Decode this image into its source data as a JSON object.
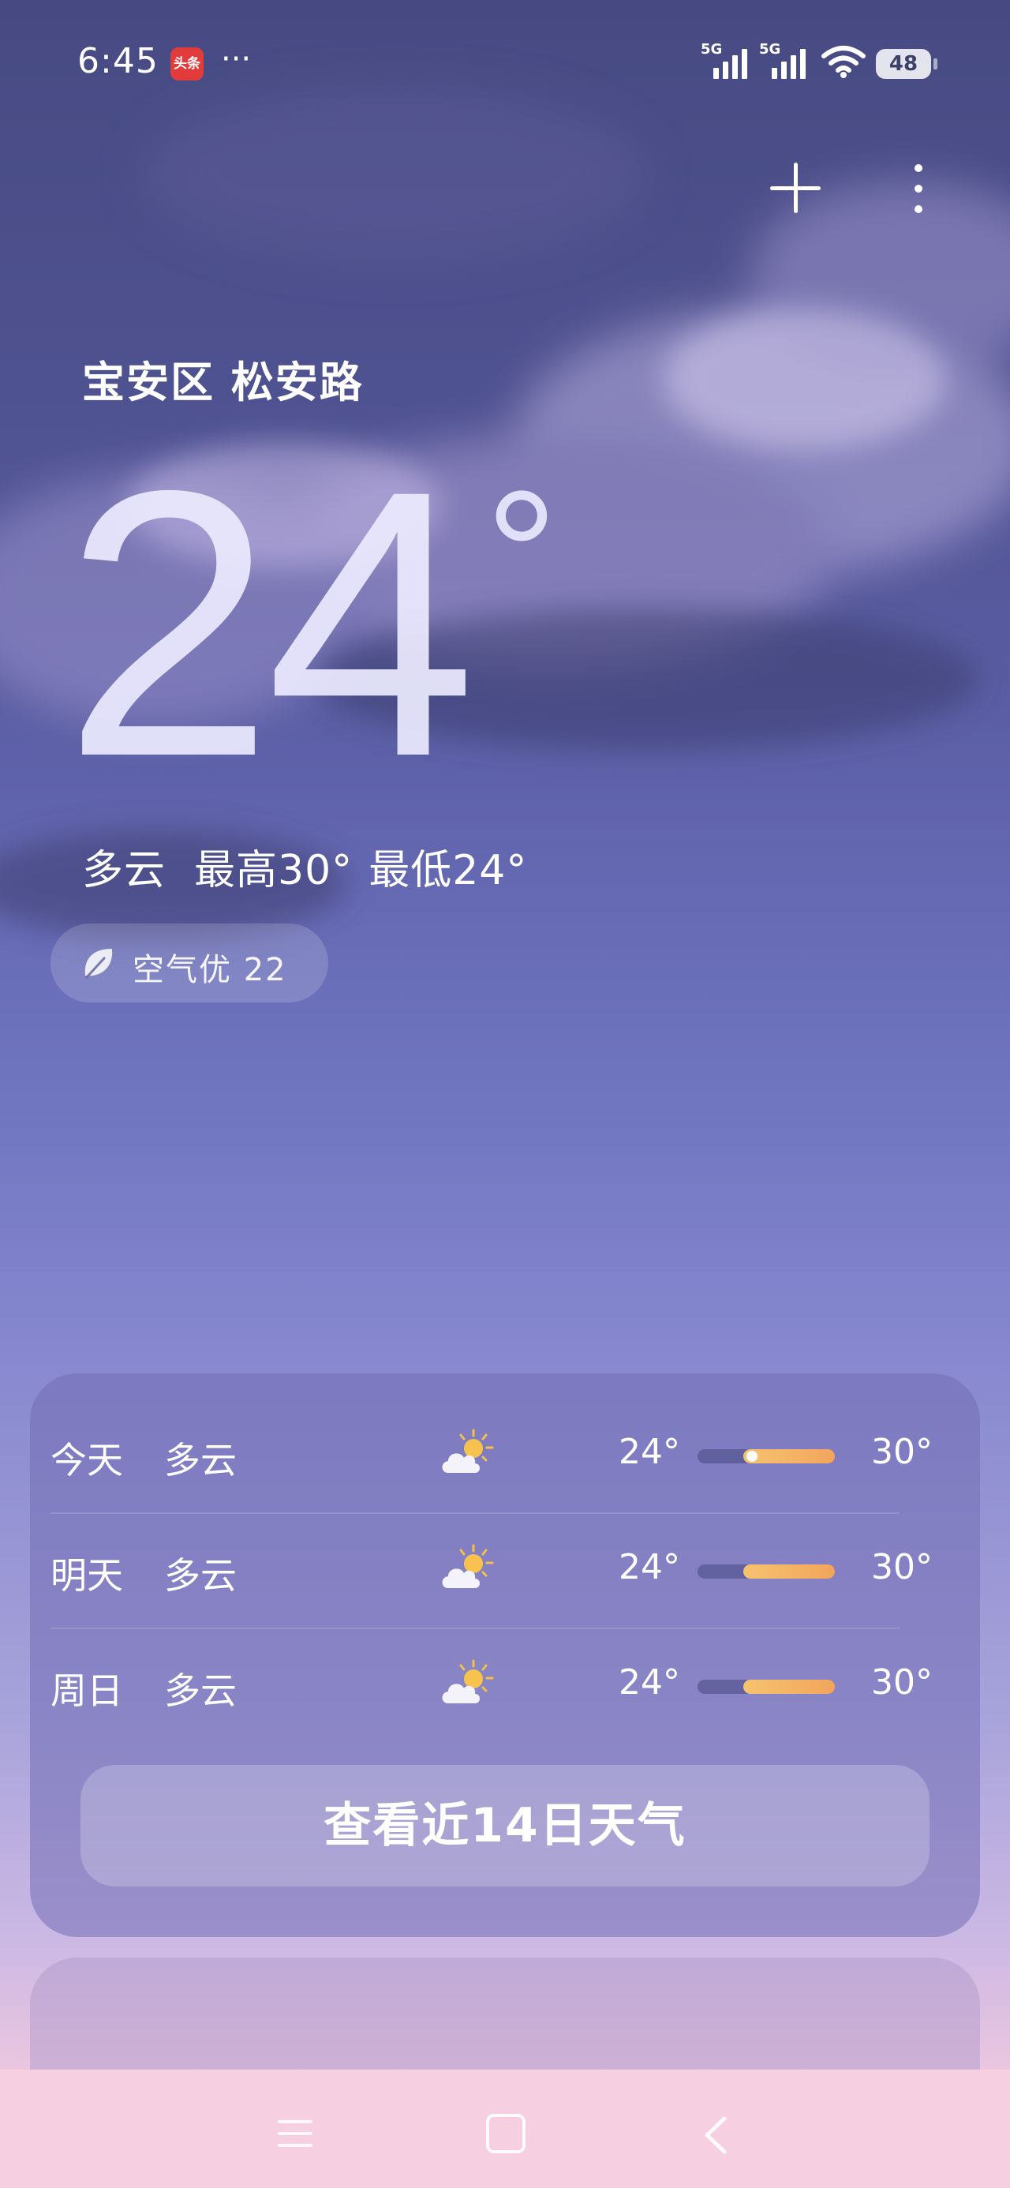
{
  "status_bar": {
    "time": "6:45",
    "news_badge": "头条",
    "more": "···",
    "network1": "5G",
    "network2": "5G",
    "battery": "48"
  },
  "location": "宝安区 松安路",
  "current": {
    "temperature": "24",
    "degree_symbol": "°",
    "condition": "多云",
    "high": "最高30°",
    "low": "最低24°",
    "aqi": "空气优 22"
  },
  "forecast": [
    {
      "day": "今天",
      "condition": "多云",
      "low": "24°",
      "high": "30°",
      "icon": "partly-cloudy-icon",
      "current_marker": true
    },
    {
      "day": "明天",
      "condition": "多云",
      "low": "24°",
      "high": "30°",
      "icon": "partly-cloudy-icon",
      "current_marker": false
    },
    {
      "day": "周日",
      "condition": "多云",
      "low": "24°",
      "high": "30°",
      "icon": "partly-cloudy-icon",
      "current_marker": false
    }
  ],
  "cta_label": "查看近14日天气",
  "colors": {
    "temp_bar_start": "#f6c36f",
    "temp_bar_end": "#f2a55c",
    "news_badge": "#e23b3b"
  }
}
